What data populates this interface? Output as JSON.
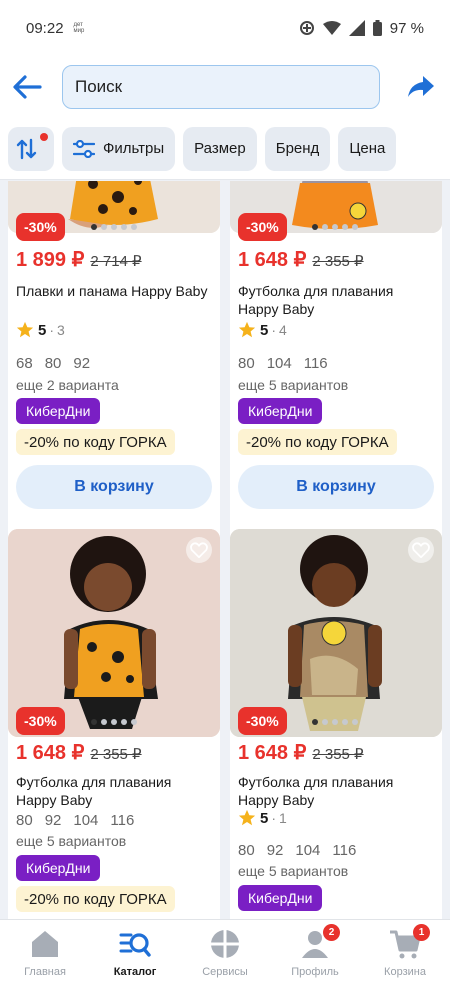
{
  "status": {
    "time": "09:22",
    "mini_label": "дет мир",
    "battery": "97 %"
  },
  "search": {
    "placeholder": "Поиск"
  },
  "filters": [
    {
      "label": "Фильтры"
    },
    {
      "label": "Размер"
    },
    {
      "label": "Бренд"
    },
    {
      "label": "Цена"
    }
  ],
  "products": [
    {
      "discount": "-30%",
      "price": "1 899 ₽",
      "old_price": "2 714 ₽",
      "title": "Плавки и панама Happy Baby",
      "rating": "5",
      "rating_count": "3",
      "sizes": [
        "68",
        "80",
        "92"
      ],
      "variants": "еще 2 варианта",
      "tag": "КиберДни",
      "promo": "-20% по коду ГОРКА",
      "cart": "В корзину"
    },
    {
      "discount": "-30%",
      "price": "1 648 ₽",
      "old_price": "2 355 ₽",
      "title": "Футболка для плавания Happy Baby",
      "rating": "5",
      "rating_count": "4",
      "sizes": [
        "80",
        "104",
        "116"
      ],
      "variants": "еще 5 вариантов",
      "tag": "КиберДни",
      "promo": "-20% по коду ГОРКА",
      "cart": "В корзину"
    },
    {
      "discount": "-30%",
      "price": "1 648 ₽",
      "old_price": "2 355 ₽",
      "title": "Футболка для плавания Happy Baby",
      "sizes": [
        "80",
        "92",
        "104",
        "116"
      ],
      "variants": "еще 5 вариантов",
      "tag": "КиберДни",
      "promo": "-20% по коду ГОРКА"
    },
    {
      "discount": "-30%",
      "price": "1 648 ₽",
      "old_price": "2 355 ₽",
      "title": "Футболка для плавания Happy Baby",
      "rating": "5",
      "rating_count": "1",
      "sizes": [
        "80",
        "92",
        "104",
        "116"
      ],
      "variants": "еще 5 вариантов",
      "tag": "КиберДни"
    }
  ],
  "tabs": [
    {
      "label": "Главная",
      "icon": "home-icon"
    },
    {
      "label": "Каталог",
      "icon": "catalog-search-icon"
    },
    {
      "label": "Сервисы",
      "icon": "services-icon"
    },
    {
      "label": "Профиль",
      "icon": "profile-icon",
      "badge": "2"
    },
    {
      "label": "Корзина",
      "icon": "cart-icon",
      "badge": "1"
    }
  ],
  "colors": {
    "accent_blue": "#1f6fd6",
    "discount_red": "#e8322c",
    "cyber_purple": "#7a1fc4",
    "promo_yellow": "#fdf3d2"
  }
}
